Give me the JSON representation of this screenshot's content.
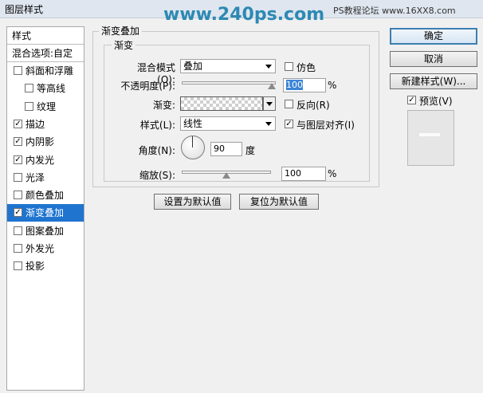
{
  "window": {
    "title": "图层样式"
  },
  "watermark": {
    "main": "www.240ps.com",
    "side": "PS教程论坛 www.16XX8.com"
  },
  "left_panel": {
    "header": "样式",
    "blend_options": "混合选项:自定",
    "items": [
      {
        "label": "斜面和浮雕",
        "checked": false,
        "indent": false
      },
      {
        "label": "等高线",
        "checked": false,
        "indent": true
      },
      {
        "label": "纹理",
        "checked": false,
        "indent": true
      },
      {
        "label": "描边",
        "checked": true,
        "indent": false
      },
      {
        "label": "内阴影",
        "checked": true,
        "indent": false
      },
      {
        "label": "内发光",
        "checked": true,
        "indent": false
      },
      {
        "label": "光泽",
        "checked": false,
        "indent": false
      },
      {
        "label": "颜色叠加",
        "checked": false,
        "indent": false
      },
      {
        "label": "渐变叠加",
        "checked": true,
        "indent": false,
        "selected": true
      },
      {
        "label": "图案叠加",
        "checked": false,
        "indent": false
      },
      {
        "label": "外发光",
        "checked": false,
        "indent": false
      },
      {
        "label": "投影",
        "checked": false,
        "indent": false
      }
    ]
  },
  "gradient_overlay": {
    "section_title": "渐变叠加",
    "subsection_title": "渐变",
    "blend_mode_label": "混合模式(O):",
    "blend_mode_value": "叠加",
    "dither_label": "仿色",
    "dither_checked": false,
    "opacity_label": "不透明度(P):",
    "opacity_value": "100",
    "opacity_unit": "%",
    "opacity_level": 1.0,
    "gradient_label": "渐变:",
    "reverse_label": "反向(R)",
    "reverse_checked": false,
    "style_label": "样式(L):",
    "style_value": "线性",
    "align_label": "与图层对齐(I)",
    "align_checked": true,
    "angle_label": "角度(N):",
    "angle_value": "90",
    "angle_unit": "度",
    "scale_label": "缩放(S):",
    "scale_value": "100",
    "scale_unit": "%",
    "scale_level": 0.5,
    "make_default": "设置为默认值",
    "reset_default": "复位为默认值"
  },
  "right_panel": {
    "ok": "确定",
    "cancel": "取消",
    "new_style": "新建样式(W)...",
    "preview_label": "预览(V)",
    "preview_checked": true
  },
  "colors": {
    "selection": "#1f74d0",
    "watermark": "#2d89b3"
  }
}
